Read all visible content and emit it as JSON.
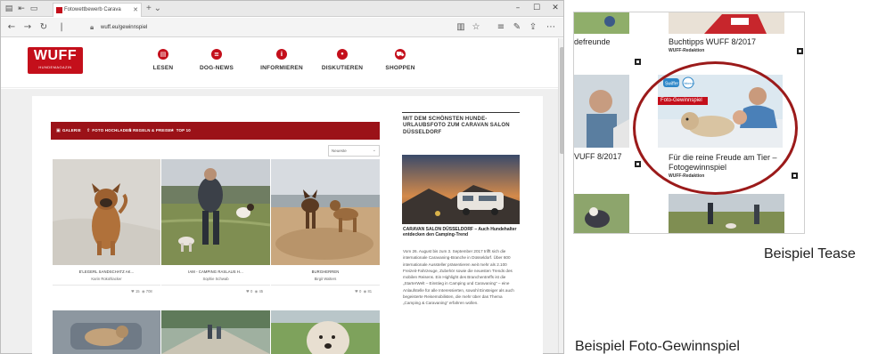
{
  "browser": {
    "tab_title": "Fotowettbewerb Carava",
    "url": "wuff.eu/gewinnspiel",
    "window_controls": [
      "–",
      "☐",
      "✕"
    ]
  },
  "site": {
    "logo_text": "WUFF",
    "logo_sub": "HUNDEMAGAZIN",
    "menu": [
      {
        "label": "LESEN",
        "icon": "book-icon"
      },
      {
        "label": "DOG-NEWS",
        "icon": "news-icon"
      },
      {
        "label": "INFORMIEREN",
        "icon": "info-icon"
      },
      {
        "label": "DISKUTIEREN",
        "icon": "chat-icon"
      },
      {
        "label": "SHOPPEN",
        "icon": "cart-icon"
      }
    ],
    "accent": "#c40f1b",
    "bar_color": "#9b1218"
  },
  "gallery": {
    "tabs": [
      {
        "label": "GALERIE",
        "icon": "image-icon"
      },
      {
        "label": "FOTO HOCHLADEN",
        "icon": "upload-icon"
      },
      {
        "label": "REGELN & PREISE",
        "icon": "info-icon"
      },
      {
        "label": "TOP 10",
        "icon": "star-icon"
      }
    ],
    "sort_value": "Neueste",
    "items": [
      {
        "title": "E'LEGERL SANDSCHATZ AK...",
        "author": "Karin Rokohlacker",
        "likes": "15",
        "views": "708"
      },
      {
        "title": "IAM - CAMPING RASLAUS H...",
        "author": "Sophie Schwab",
        "likes": "0",
        "views": "45"
      },
      {
        "title": "BURGHERREN",
        "author": "Birgit Walters",
        "likes": "0",
        "views": "81"
      }
    ]
  },
  "sidebar": {
    "heading": "MIT DEM SCHÖNSTEN HUNDE-URLAUBSFOTO ZUM CARAVAN SALON DÜSSELDORF",
    "article_title": "CARAVAN SALON DÜSSELDORF – Auch Hundehalter entdecken den Camping-Trend",
    "article_body": "Vom 26. August bis zum 3. September 2017 trifft sich die internationale Caravaning-Branche in Düsseldorf. Über 600 internationale Aussteller präsentieren weit mehr als 2.100 Freizeit-Fahrzeuge, Zubehör sowie die neuesten Trends des mobilen Reisens. Ein Highlight des Branchentreffs ist die „StarterWelt – Einstieg in Camping und Caravaning“ – eine Anlaufstelle für alle Interessierten, sowohl Einsteiger als auch begeisterte Reisemobilisten, die mehr über das Thema „Camping & Caravaning“ erfahren wollen."
  },
  "teaser": {
    "top_left": "defreunde",
    "top_right": "Buchtipps WUFF 8/2017",
    "top_right_author": "WUFF-Redaktion",
    "mid_left": "VUFF 8/2017",
    "badge": "Foto-Gewinnspiel",
    "brand_1": "Swiffer",
    "brand_2": "febreze",
    "feature_title": "Für die reine Freude am Tier –\nFotogewinnspiel",
    "feature_author": "WUFF-Redaktion"
  },
  "captions": {
    "teaser_caption": "Beispiel Tease",
    "gewinnspiel_caption": "Beispiel Foto-Gewinnspiel"
  }
}
